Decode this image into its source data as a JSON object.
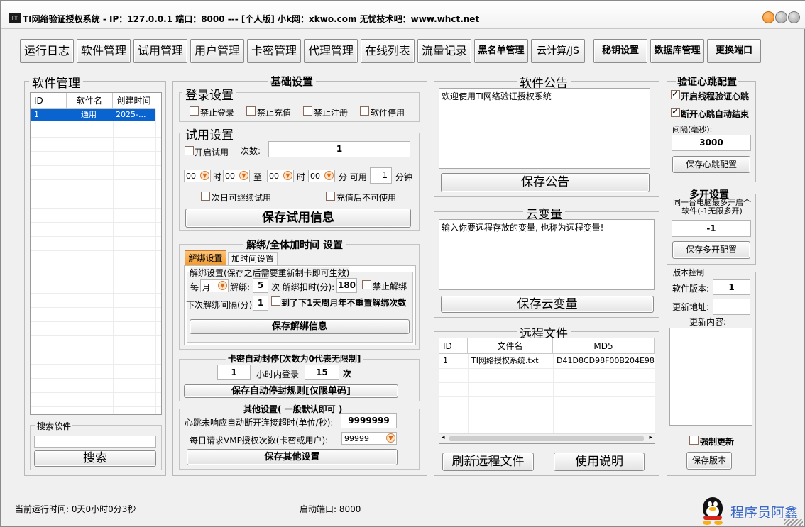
{
  "window": {
    "icon_text": "IT",
    "title": "TI网络验证授权系统 - IP：127.0.0.1 端口：8000   ---   [个人版] 小k网：xkwo.com  无忧技术吧：www.whct.net"
  },
  "toolbar": [
    {
      "label": "运行日志"
    },
    {
      "label": "软件管理"
    },
    {
      "label": "试用管理"
    },
    {
      "label": "用户管理"
    },
    {
      "label": "卡密管理"
    },
    {
      "label": "代理管理"
    },
    {
      "label": "在线列表"
    },
    {
      "label": "流量记录"
    },
    {
      "label": "黑名单管理"
    },
    {
      "label": "云计算/JS"
    },
    {
      "label": "秘钥设置"
    },
    {
      "label": "数据库管理"
    },
    {
      "label": "更换端口"
    }
  ],
  "software_panel": {
    "title": "软件管理",
    "columns": [
      "ID",
      "软件名",
      "创建时间"
    ],
    "rows": [
      {
        "id": "1",
        "name": "通用",
        "created": "2025-..."
      }
    ],
    "search_group": "搜索软件",
    "search_value": "",
    "search_button": "搜索"
  },
  "basic": {
    "title": "基础设置",
    "login_title": "登录设置",
    "login_options": [
      {
        "label": "禁止登录",
        "checked": false
      },
      {
        "label": "禁止充值",
        "checked": false
      },
      {
        "label": "禁止注册",
        "checked": false
      },
      {
        "label": "软件停用",
        "checked": false
      }
    ],
    "trial_title": "试用设置",
    "trial_enable": "开启试用",
    "trial_count_label": "次数:",
    "trial_count": "1",
    "time_from_h": "00",
    "time_h_unit": "时",
    "time_from_m": "00",
    "time_to": "至",
    "time_to_h": "00",
    "time_to_h_unit": "时",
    "time_to_m": "00",
    "time_available": "分 可用",
    "minutes": "1",
    "minutes_unit": "分钟",
    "next_day": "次日可继续试用",
    "after_recharge": "充值后不可使用",
    "save_trial": "保存试用信息",
    "unbind_title": "解绑/全体加时间 设置",
    "tab_unbind": "解绑设置",
    "tab_addtime": "加时间设置",
    "unbind_group": "解绑设置(保存之后需要重新制卡即可生效)",
    "per_label": "每",
    "period": "月",
    "unbind_label": "解绑:",
    "unbind_times": "5",
    "deduct_label": "次 解绑扣时(分):",
    "deduct_minutes": "180",
    "forbid_unbind": "禁止解绑",
    "interval_label": "下次解绑间隔(分)",
    "interval_value": "1",
    "no_reset": "到了下1天周月年不重置解绑次数",
    "save_unbind": "保存解绑信息",
    "card_title": "卡密自动封停[次数为0代表无限制]",
    "card_count": "1",
    "card_hours_label": "小时内登录",
    "card_times": "15",
    "card_times_unit": "次",
    "save_card": "保存自动停封规则[仅限单码]",
    "other_title": "其他设置( 一般默认即可 )",
    "heartbeat_timeout_label": "心跳未响应自动断开连接超时(单位/秒):",
    "heartbeat_timeout": "9999999",
    "daily_label": "每日请求VMP授权次数(卡密或用户):",
    "daily_value": "99999",
    "save_other": "保存其他设置"
  },
  "notice": {
    "title": "软件公告",
    "text": "欢迎使用TI网络验证授权系统",
    "save": "保存公告"
  },
  "cloud_var": {
    "title": "云变量",
    "text": "输入你要远程存放的变量, 也称为远程变量!",
    "save": "保存云变量"
  },
  "remote_files": {
    "title": "远程文件",
    "columns": [
      "ID",
      "文件名",
      "MD5"
    ],
    "rows": [
      {
        "id": "1",
        "name": "TI网络授权系统.txt",
        "md5": "D41D8CD98F00B204E980..."
      }
    ],
    "refresh": "刷新远程文件",
    "help": "使用说明"
  },
  "heartbeat": {
    "title": "验证心跳配置",
    "open_thread": {
      "label": "开启线程验证心跳",
      "checked": true
    },
    "auto_end": {
      "label": "断开心跳自动结束",
      "checked": true
    },
    "interval_label": "间隔(毫秒):",
    "interval": "3000",
    "save": "保存心跳配置"
  },
  "multi": {
    "title": "多开设置",
    "desc": "同一台电脑最多开启个软件(-1无限多开)",
    "value": "-1",
    "save": "保存多开配置"
  },
  "version": {
    "title": "版本控制",
    "version_label": "软件版本:",
    "version_value": "1",
    "url_label": "更新地址:",
    "url_value": "",
    "content_label": "更新内容:",
    "content_value": "",
    "force": "强制更新",
    "save": "保存版本"
  },
  "statusbar": {
    "runtime": "当前运行时间: 0天0小时0分3秒",
    "port": "启动端口: 8000"
  },
  "watermark": "程序员阿鑫",
  "colors": {
    "selected_row": "#0a64d0",
    "tab_active": "#f7a23e",
    "close_button": "#f0871f"
  }
}
